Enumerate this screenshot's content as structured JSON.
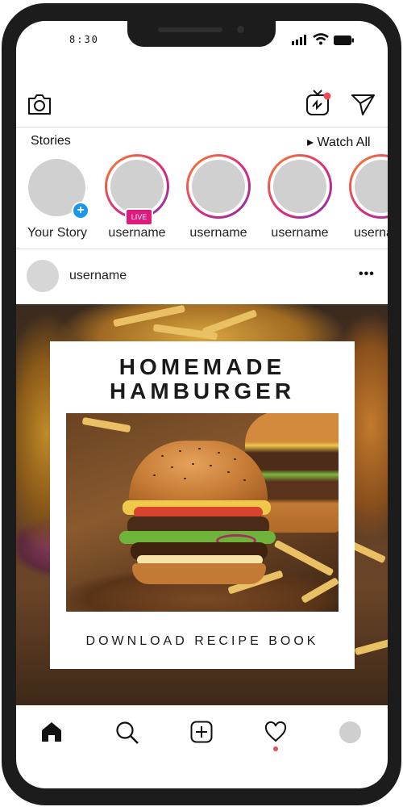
{
  "status_bar": {
    "time": "8:30"
  },
  "stories": {
    "label": "Stories",
    "watch_all": "▸ Watch All",
    "items": [
      {
        "label": "Your Story"
      },
      {
        "label": "username",
        "badge": "LIVE"
      },
      {
        "label": "username"
      },
      {
        "label": "username"
      },
      {
        "label": "username"
      }
    ]
  },
  "post": {
    "username": "username",
    "more": "•••",
    "card": {
      "title_line1": "HOMEMADE",
      "title_line2": "HAMBURGER",
      "footer": "DOWNLOAD RECIPE BOOK"
    }
  },
  "colors": {
    "live_badge": "#e0197d",
    "add_story": "#1a96f0",
    "notification_dot": "#f04a5a"
  },
  "icons": {
    "header_left": "camera-icon",
    "header_right": [
      "igtv-icon",
      "direct-message-icon"
    ],
    "nav": [
      "home-icon",
      "search-icon",
      "add-post-icon",
      "heart-icon",
      "profile-icon"
    ]
  }
}
